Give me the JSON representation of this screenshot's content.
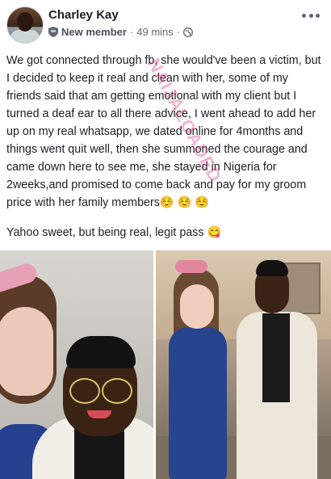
{
  "post": {
    "author": "Charley Kay",
    "badge_icon": "shield-badge-icon",
    "badge": "New member",
    "separator": "·",
    "time": "49 mins",
    "separator2": "·",
    "privacy_icon": "globe-icon",
    "more_icon": "ellipsis-icon",
    "paragraph1": "We got connected through fb, she would've been a victim, but I decided to keep it real and clean with her, some of my friends said that am getting emotional with my client but I turned a deaf ear to all there advice, I went ahead to add her up on my real whatsapp, we dated online for 4months and things went quit well, then she summoned the courage and came down here to see me, she stayed in Nigeria for 2weeks,and promised to come back and pay for my groom price with her family members☺️ ☺️ ☺️",
    "paragraph2": "Yahoo sweet, but being real, legit pass 😋",
    "watermark": "NAIJALOADED",
    "photos": [
      {
        "name": "selfie-photo",
        "alt": "couple-selfie"
      },
      {
        "name": "standing-photo",
        "alt": "couple-standing"
      }
    ]
  },
  "colors": {
    "text": "#1c1e21",
    "meta": "#65676b",
    "watermark": "#dc2878",
    "dress_blue": "#27408e"
  }
}
